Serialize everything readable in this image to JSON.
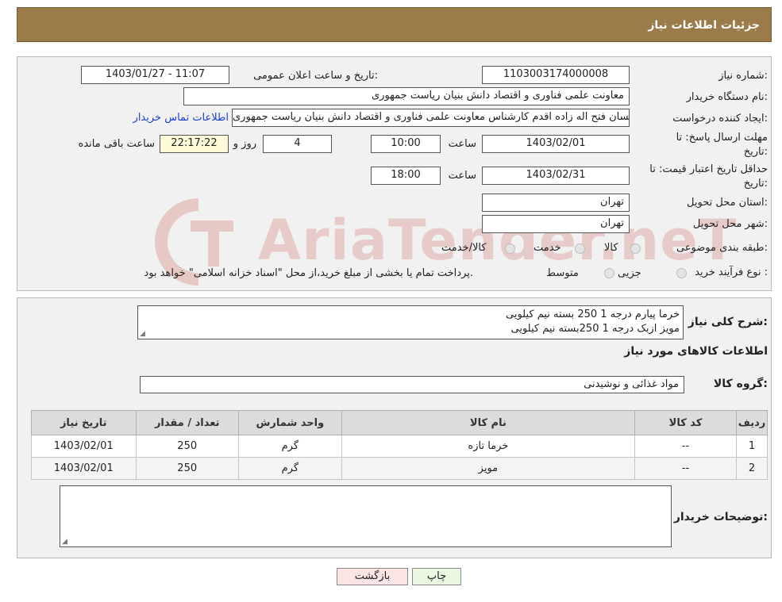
{
  "header": {
    "title": "جزئیات اطلاعات نیاز"
  },
  "form": {
    "need_number_label": "شماره نیاز:",
    "need_number": "1103003174000008",
    "announce_label": "تاریخ و ساعت اعلان عمومی:",
    "announce_value": "1403/01/27 - 11:07",
    "buyer_org_label": "نام دستگاه خریدار:",
    "buyer_org": "معاونت علمی فناوری و اقتصاد دانش بنیان ریاست جمهوری",
    "creator_label": "ایجاد کننده درخواست:",
    "creator": "احسان فتح اله زاده اقدم کارشناس معاونت علمی فناوری و اقتصاد دانش بنیان ریاست جمهوری",
    "contact_link": "اطلاعات تماس خریدار",
    "deadline_label_1": "مهلت ارسال پاسخ: تا",
    "deadline_label_2": "تاریخ:",
    "deadline_date": "1403/02/01",
    "time_label": "ساعت",
    "deadline_time": "10:00",
    "days_value": "4",
    "days_label": "روز و",
    "remaining_value": "22:17:22",
    "remaining_label": "ساعت باقی مانده",
    "validity_label_1": "حداقل تاریخ اعتبار قیمت: تا",
    "validity_label_2": "تاریخ:",
    "validity_date": "1403/02/31",
    "validity_time": "18:00",
    "province_label": "استان محل تحویل:",
    "province": "تهران",
    "city_label": "شهر محل تحویل:",
    "city": "تهران",
    "category_label": "طبقه بندی موضوعی:",
    "category_options": [
      "کالا",
      "خدمت",
      "کالا/خدمت"
    ],
    "purchase_type_label": "نوع فرآیند خرید :",
    "purchase_options": [
      "جزیی",
      "متوسط"
    ],
    "purchase_note": "پرداخت تمام یا بخشی از مبلغ خرید،از محل \"اسناد خزانه اسلامی\" خواهد بود."
  },
  "details": {
    "description_label": "شرح کلی نیاز:",
    "description_lines": [
      "خرما پیارم درجه 1 250 بسته نیم کیلویی",
      "مویز ازبک درجه 1 250بسته نیم کیلویی"
    ],
    "goods_info_title": "اطلاعات کالاهای مورد نیاز",
    "goods_group_label": "گروه کالا:",
    "goods_group": "مواد غذائی و نوشیدنی",
    "table": {
      "headers": [
        "ردیف",
        "کد کالا",
        "نام کالا",
        "واحد شمارش",
        "تعداد / مقدار",
        "تاریخ نیاز"
      ],
      "rows": [
        [
          "1",
          "--",
          "خرما تازه",
          "گرم",
          "250",
          "1403/02/01"
        ],
        [
          "2",
          "--",
          "مویز",
          "گرم",
          "250",
          "1403/02/01"
        ]
      ]
    },
    "buyer_notes_label": "توضیحات خریدار:"
  },
  "buttons": {
    "print": "چاپ",
    "back": "بازگشت"
  },
  "watermark": {
    "text": "AriaTender.neT"
  },
  "colors": {
    "header_bg": "#9b7b4a",
    "link": "#1a3ed6",
    "print_btn": "#eaf7e1",
    "back_btn": "#fbe4e4"
  }
}
